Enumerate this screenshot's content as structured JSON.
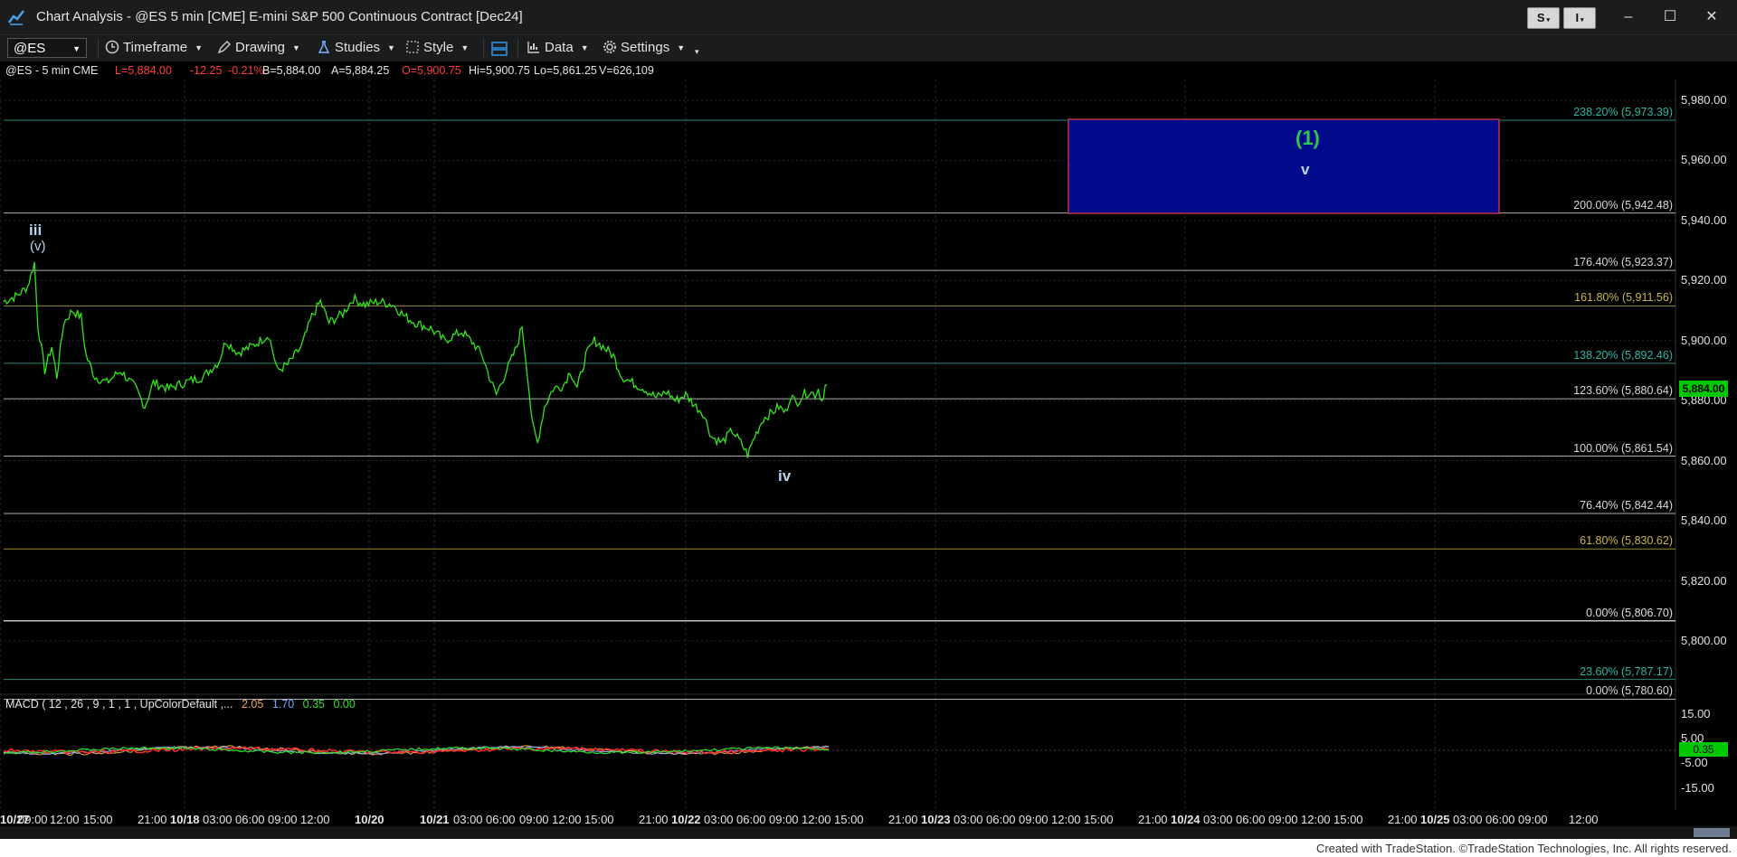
{
  "window": {
    "title": "Chart Analysis - @ES 5 min [CME] E-mini S&P 500 Continuous Contract [Dec24]",
    "s_button": "S",
    "i_button": "I",
    "minimize": "–",
    "maximize": "☐",
    "close": "✕"
  },
  "toolbar": {
    "symbol": "@ES",
    "timeframe": "Timeframe",
    "drawing": "Drawing",
    "studies": "Studies",
    "style": "Style",
    "data": "Data",
    "settings": "Settings"
  },
  "header": {
    "symbol_info": "@ES - 5 min  CME",
    "last": "L=5,884.00",
    "change": "-12.25",
    "change_pct": "-0.21%",
    "bid": "B=5,884.00",
    "ask": "A=5,884.25",
    "open": "O=5,900.75",
    "high": "Hi=5,900.75",
    "low": "Lo=5,861.25",
    "volume": "V=626,109"
  },
  "colors": {
    "background": "#000000",
    "price_line": "#33e61a",
    "target_box": "#000a8a",
    "target_border": "#c0304a",
    "wave_green": "#2ec84c",
    "wave_blue": "#b8d6f2"
  },
  "fib_levels": [
    {
      "label": "238.20% (5,973.39)",
      "price": 5973.39,
      "color": "#2fb3a2"
    },
    {
      "label": "200.00% (5,942.48)",
      "price": 5942.48,
      "color": "#e8e8e8"
    },
    {
      "label": "176.40% (5,923.37)",
      "price": 5923.37,
      "color": "#e8e8e8"
    },
    {
      "label": "161.80% (5,911.56)",
      "price": 5911.56,
      "color": "#c8b84a"
    },
    {
      "label": "138.20% (5,892.46)",
      "price": 5892.46,
      "color": "#2fb3a2"
    },
    {
      "label": "123.60% (5,880.64)",
      "price": 5880.64,
      "color": "#e8e8e8"
    },
    {
      "label": "100.00% (5,861.54)",
      "price": 5861.54,
      "color": "#e8e8e8"
    },
    {
      "label": "76.40% (5,842.44)",
      "price": 5842.44,
      "color": "#e8e8e8"
    },
    {
      "label": "61.80% (5,830.62)",
      "price": 5830.62,
      "color": "#c8b84a"
    },
    {
      "label": "0.00% (5,806.70)",
      "price": 5806.7,
      "color": "#ffffff"
    },
    {
      "label": "23.60% (5,787.17)",
      "price": 5787.17,
      "color": "#2fb3a2"
    },
    {
      "label": "0.00% (5,780.60)",
      "price": 5780.6,
      "color": "#e8e8e8"
    }
  ],
  "price_axis": [
    "5,980.00",
    "5,960.00",
    "5,940.00",
    "5,920.00",
    "5,900.00",
    "5,880.00",
    "5,860.00",
    "5,840.00",
    "5,820.00",
    "5,800.00"
  ],
  "current_price": "5,884.00",
  "waves": {
    "iii": "iii",
    "iii_sub": "(v)",
    "iv": "iv",
    "target_wave": "(1)",
    "target_sub": "v"
  },
  "macd": {
    "legend": "MACD ( 12 , 26 , 9 , 1 , 1 , UpColorDefault ,...",
    "v1": "2.05",
    "v2": "1.70",
    "v3": "0.35",
    "v4": "0.00",
    "ticks": [
      "15.00",
      "5.00",
      "-5.00",
      "-15.00"
    ],
    "current": "0.35"
  },
  "time_axis": [
    {
      "t": "09:00",
      "b": false
    },
    {
      "t": "12:00",
      "b": false
    },
    {
      "t": "15:00",
      "b": false
    },
    {
      "t": "21:00",
      "b": false
    },
    {
      "t": "10/18",
      "b": true
    },
    {
      "t": "03:00",
      "b": false
    },
    {
      "t": "06:00",
      "b": false
    },
    {
      "t": "09:00",
      "b": false
    },
    {
      "t": "12:00",
      "b": false
    },
    {
      "t": "10/20",
      "b": true
    },
    {
      "t": "10/21",
      "b": true
    },
    {
      "t": "03:00",
      "b": false
    },
    {
      "t": "06:00",
      "b": false
    },
    {
      "t": "09:00",
      "b": false
    },
    {
      "t": "12:00",
      "b": false
    },
    {
      "t": "15:00",
      "b": false
    },
    {
      "t": "21:00",
      "b": false
    },
    {
      "t": "10/22",
      "b": true
    },
    {
      "t": "03:00",
      "b": false
    },
    {
      "t": "06:00",
      "b": false
    },
    {
      "t": "09:00",
      "b": false
    },
    {
      "t": "12:00",
      "b": false
    },
    {
      "t": "15:00",
      "b": false
    },
    {
      "t": "21:00",
      "b": false
    },
    {
      "t": "10/23",
      "b": true
    },
    {
      "t": "03:00",
      "b": false
    },
    {
      "t": "06:00",
      "b": false
    },
    {
      "t": "09:00",
      "b": false
    },
    {
      "t": "12:00",
      "b": false
    },
    {
      "t": "15:00",
      "b": false
    },
    {
      "t": "21:00",
      "b": false
    },
    {
      "t": "10/24",
      "b": true
    },
    {
      "t": "03:00",
      "b": false
    },
    {
      "t": "06:00",
      "b": false
    },
    {
      "t": "09:00",
      "b": false
    },
    {
      "t": "12:00",
      "b": false
    },
    {
      "t": "15:00",
      "b": false
    },
    {
      "t": "21:00",
      "b": false
    },
    {
      "t": "10/25",
      "b": true
    },
    {
      "t": "03:00",
      "b": false
    },
    {
      "t": "06:00",
      "b": false
    },
    {
      "t": "09:00",
      "b": false
    },
    {
      "t": "12:00",
      "b": false
    },
    {
      "t": "10/27",
      "b": true
    }
  ],
  "footer": "Created with TradeStation. ©TradeStation Technologies, Inc. All rights reserved."
}
